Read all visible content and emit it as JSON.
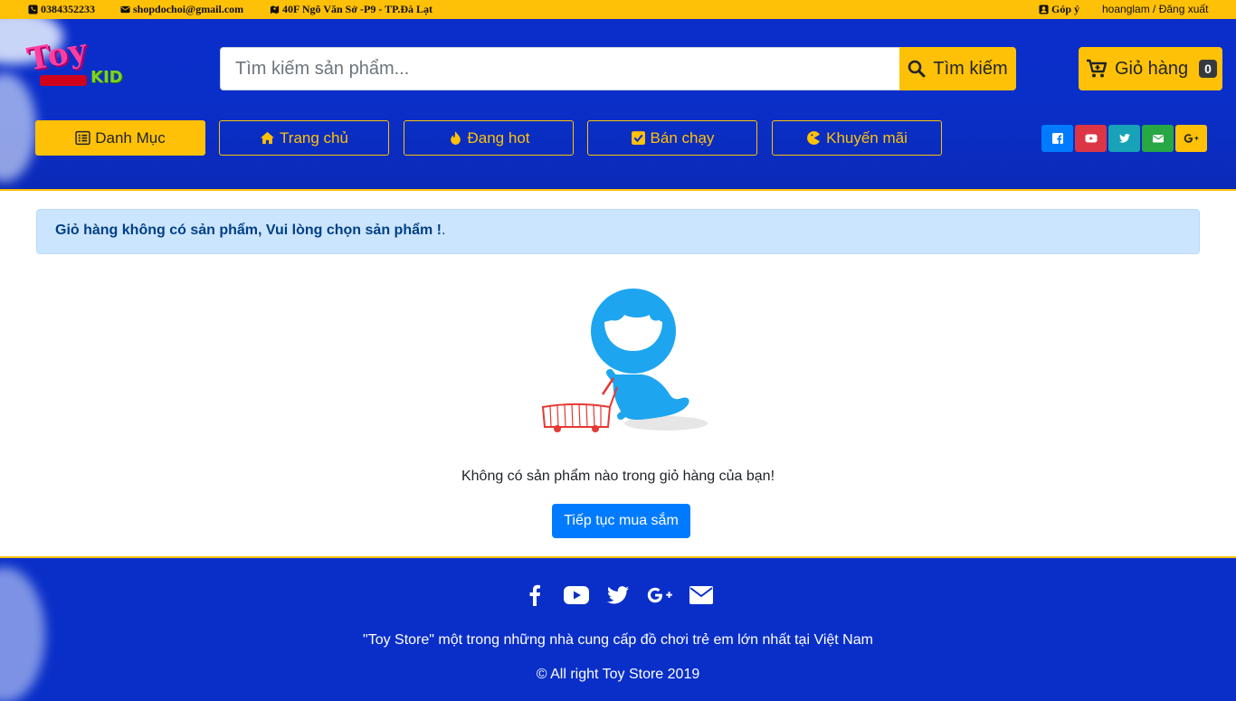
{
  "topbar": {
    "phone": "0384352233",
    "email": "shopdochoi@gmail.com",
    "address": "40F Ngô Văn Sở -P9 - TP.Đà Lạt",
    "feedback": "Góp ý",
    "account": "hoanglam / Đăng xuất"
  },
  "header": {
    "logo_top": "Toy",
    "logo_bottom": "KID",
    "search_placeholder": "Tìm kiếm sản phẩm...",
    "search_button": "Tìm kiếm",
    "cart_label": "Giỏ hàng",
    "cart_count": "0"
  },
  "nav": {
    "category": "Danh Mục",
    "home": "Trang chủ",
    "hot": "Đang hot",
    "bestseller": "Bán chạy",
    "promo": "Khuyến mãi"
  },
  "social_colors": {
    "facebook": "#007bff",
    "youtube": "#dc3545",
    "twitter": "#17a2b8",
    "email": "#28a745",
    "google": "#ffc107"
  },
  "main": {
    "alert_bold": "Giỏ hàng không có sản phẩm, Vui lòng chọn sản phẩm !",
    "alert_tail": ".",
    "empty_text": "Không có sản phẩm nào trong giỏ hàng của bạn!",
    "continue_button": "Tiếp tục mua sắm"
  },
  "footer": {
    "tagline": "\"Toy Store\" một trong những nhà cung cấp đồ chơi trẻ em lớn nhất tại Việt Nam",
    "copyright": "© All right Toy Store 2019"
  }
}
